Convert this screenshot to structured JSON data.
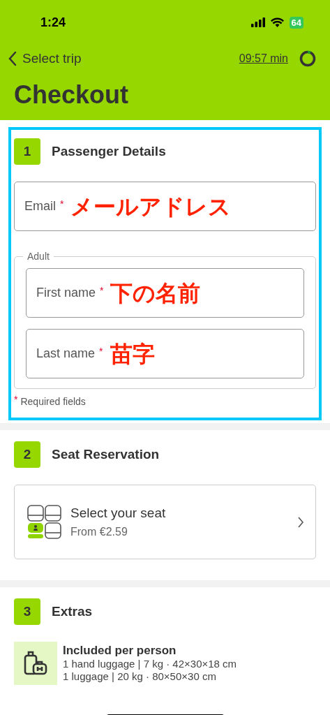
{
  "status_bar": {
    "time": "1:24",
    "battery": "64",
    "charging": true
  },
  "nav": {
    "back_label": "Select trip",
    "timer": "09:57 min"
  },
  "title": "Checkout",
  "sections": [
    {
      "number": "1",
      "title": "Passenger Details",
      "highlighted": true,
      "kind": "form",
      "fields": [
        {
          "label": "Email",
          "required_mark": "*",
          "annotation": "メールアドレス"
        }
      ],
      "group": {
        "legend": "Adult",
        "fields": [
          {
            "label": "First name",
            "required_mark": "*",
            "annotation": "下の名前"
          },
          {
            "label": "Last name",
            "required_mark": "*",
            "annotation": "苗字"
          }
        ]
      },
      "note_mark": "*",
      "note": "Required fields"
    },
    {
      "number": "2",
      "title": "Seat Reservation",
      "highlighted": false,
      "kind": "seat",
      "option": {
        "title": "Select your seat",
        "subtitle": "From €2.59"
      }
    },
    {
      "number": "3",
      "title": "Extras",
      "highlighted": false,
      "kind": "extras",
      "info": {
        "title": "Included per person",
        "lines": [
          "1 hand luggage | 7 kg · 42×30×18 cm",
          "1 luggage | 20 kg · 80×50×30 cm"
        ]
      }
    }
  ]
}
